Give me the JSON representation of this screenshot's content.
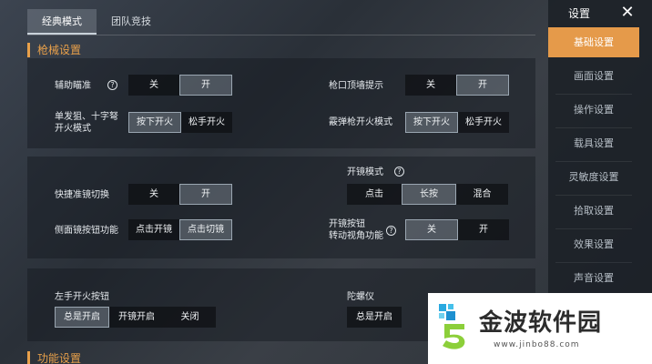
{
  "tabs": [
    {
      "label": "经典模式"
    },
    {
      "label": "团队竞技"
    }
  ],
  "sections": {
    "gun": "枪械设置",
    "func": "功能设置"
  },
  "gun": {
    "aim_assist": {
      "label": "辅助瞄准",
      "options": [
        "关",
        "开"
      ]
    },
    "muzzle_wall": {
      "label": "枪口顶墙提示",
      "options": [
        "关",
        "开"
      ]
    },
    "single_fire": {
      "label_line1": "单发狙、十字弩",
      "label_line2": "开火模式",
      "options": [
        "按下开火",
        "松手开火"
      ]
    },
    "shotgun_fire": {
      "label": "霰弹枪开火模式",
      "options": [
        "按下开火",
        "松手开火"
      ]
    },
    "quick_scope": {
      "label": "快捷准镜切换",
      "options": [
        "关",
        "开"
      ]
    },
    "scope_mode": {
      "label": "开镜模式",
      "options": [
        "点击",
        "长按",
        "混合"
      ]
    },
    "side_scope": {
      "label": "侧面镜按钮功能",
      "options": [
        "点击开镜",
        "点击切镜"
      ]
    },
    "scope_turn": {
      "label_line1": "开镜按钮",
      "label_line2": "转动视角功能",
      "options": [
        "关",
        "开"
      ]
    },
    "left_fire": {
      "label": "左手开火按钮",
      "options": [
        "总是开启",
        "开镜开启",
        "关闭"
      ]
    },
    "gyro": {
      "label": "陀螺仪",
      "options": [
        "总是开启"
      ]
    }
  },
  "help_glyph": "?",
  "sidebar": {
    "title": "设置",
    "close": "✕",
    "items": [
      {
        "label": "基础设置"
      },
      {
        "label": "画面设置"
      },
      {
        "label": "操作设置"
      },
      {
        "label": "载具设置"
      },
      {
        "label": "灵敏度设置"
      },
      {
        "label": "拾取设置"
      },
      {
        "label": "效果设置"
      },
      {
        "label": "声音设置"
      }
    ]
  },
  "watermark": {
    "text": "金波软件园",
    "url": "www.jinbo88.com"
  }
}
